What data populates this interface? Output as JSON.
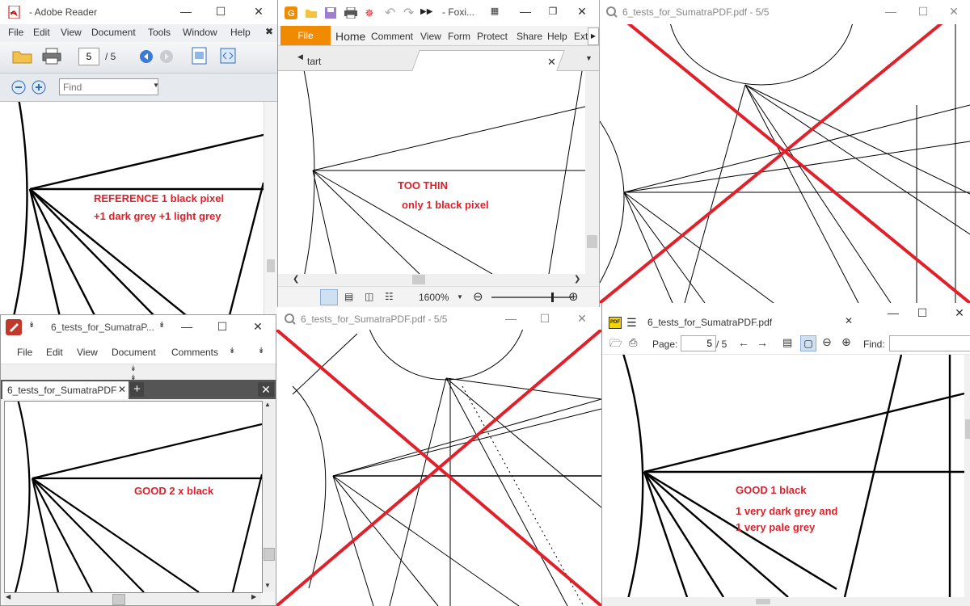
{
  "colors": {
    "annotation": "#e0202a",
    "foxit_accent": "#f08a00",
    "cross": "#e0202a"
  },
  "adobe": {
    "title": "- Adobe Reader",
    "menu": [
      "File",
      "Edit",
      "View",
      "Document",
      "Tools",
      "Window",
      "Help"
    ],
    "page_current": "5",
    "page_total": "/ 5",
    "find_placeholder": "Find",
    "annotation_line1": "REFERENCE 1 black pixel",
    "annotation_line2": "+1 dark grey +1 light grey"
  },
  "foxit": {
    "title": "- Foxi...",
    "file_tab": "File",
    "ribbon": [
      "Home",
      "Comment",
      "View",
      "Form",
      "Protect",
      "Share",
      "Help",
      "Ext"
    ],
    "doc_tab": "tart",
    "zoom": "1600%",
    "annotation_line1": "TOO THIN",
    "annotation_line2": "only 1 black pixel"
  },
  "sumatra_top": {
    "title": "6_tests_for_SumatraPDF.pdf - 5/5"
  },
  "pdfxchange": {
    "title": "6_tests_for_SumatraP...",
    "menu": [
      "File",
      "Edit",
      "View",
      "Document",
      "Comments"
    ],
    "tab": "6_tests_for_SumatraPDF",
    "annotation": "GOOD   2 x black"
  },
  "sumatra_mid": {
    "title": "6_tests_for_SumatraPDF.pdf - 5/5"
  },
  "sumatra_new": {
    "title": "6_tests_for_SumatraPDF.pdf",
    "page_label": "Page:",
    "page_current": "5",
    "page_total": "/ 5",
    "find_label": "Find:",
    "annotation_line1": "GOOD     1 black",
    "annotation_line2": "1 very dark grey and",
    "annotation_line3": "1 very pale grey"
  }
}
